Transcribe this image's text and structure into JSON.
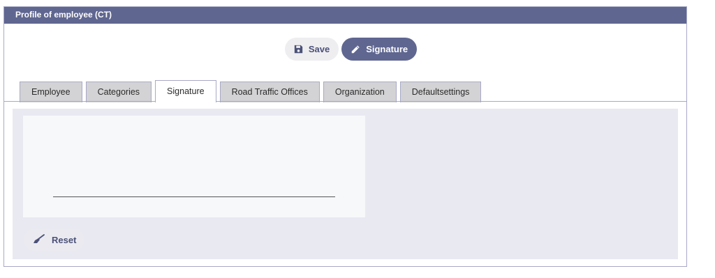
{
  "panel": {
    "title": "Profile of employee (CT)"
  },
  "toolbar": {
    "save_label": "Save",
    "save_icon": "floppy-disk-icon",
    "signature_label": "Signature",
    "signature_icon": "pencil-icon"
  },
  "tabs": [
    {
      "label": "Employee",
      "active": false
    },
    {
      "label": "Categories",
      "active": false
    },
    {
      "label": "Signature",
      "active": true
    },
    {
      "label": "Road Traffic Offices",
      "active": false
    },
    {
      "label": "Organization",
      "active": false
    },
    {
      "label": "Defaultsettings",
      "active": false
    }
  ],
  "signature_pad": {
    "reset_label": "Reset",
    "reset_icon": "broom-icon"
  },
  "colors": {
    "accent": "#5f6690",
    "content_bg": "#e9e9f2",
    "tab_bg": "#d3d3d5"
  }
}
